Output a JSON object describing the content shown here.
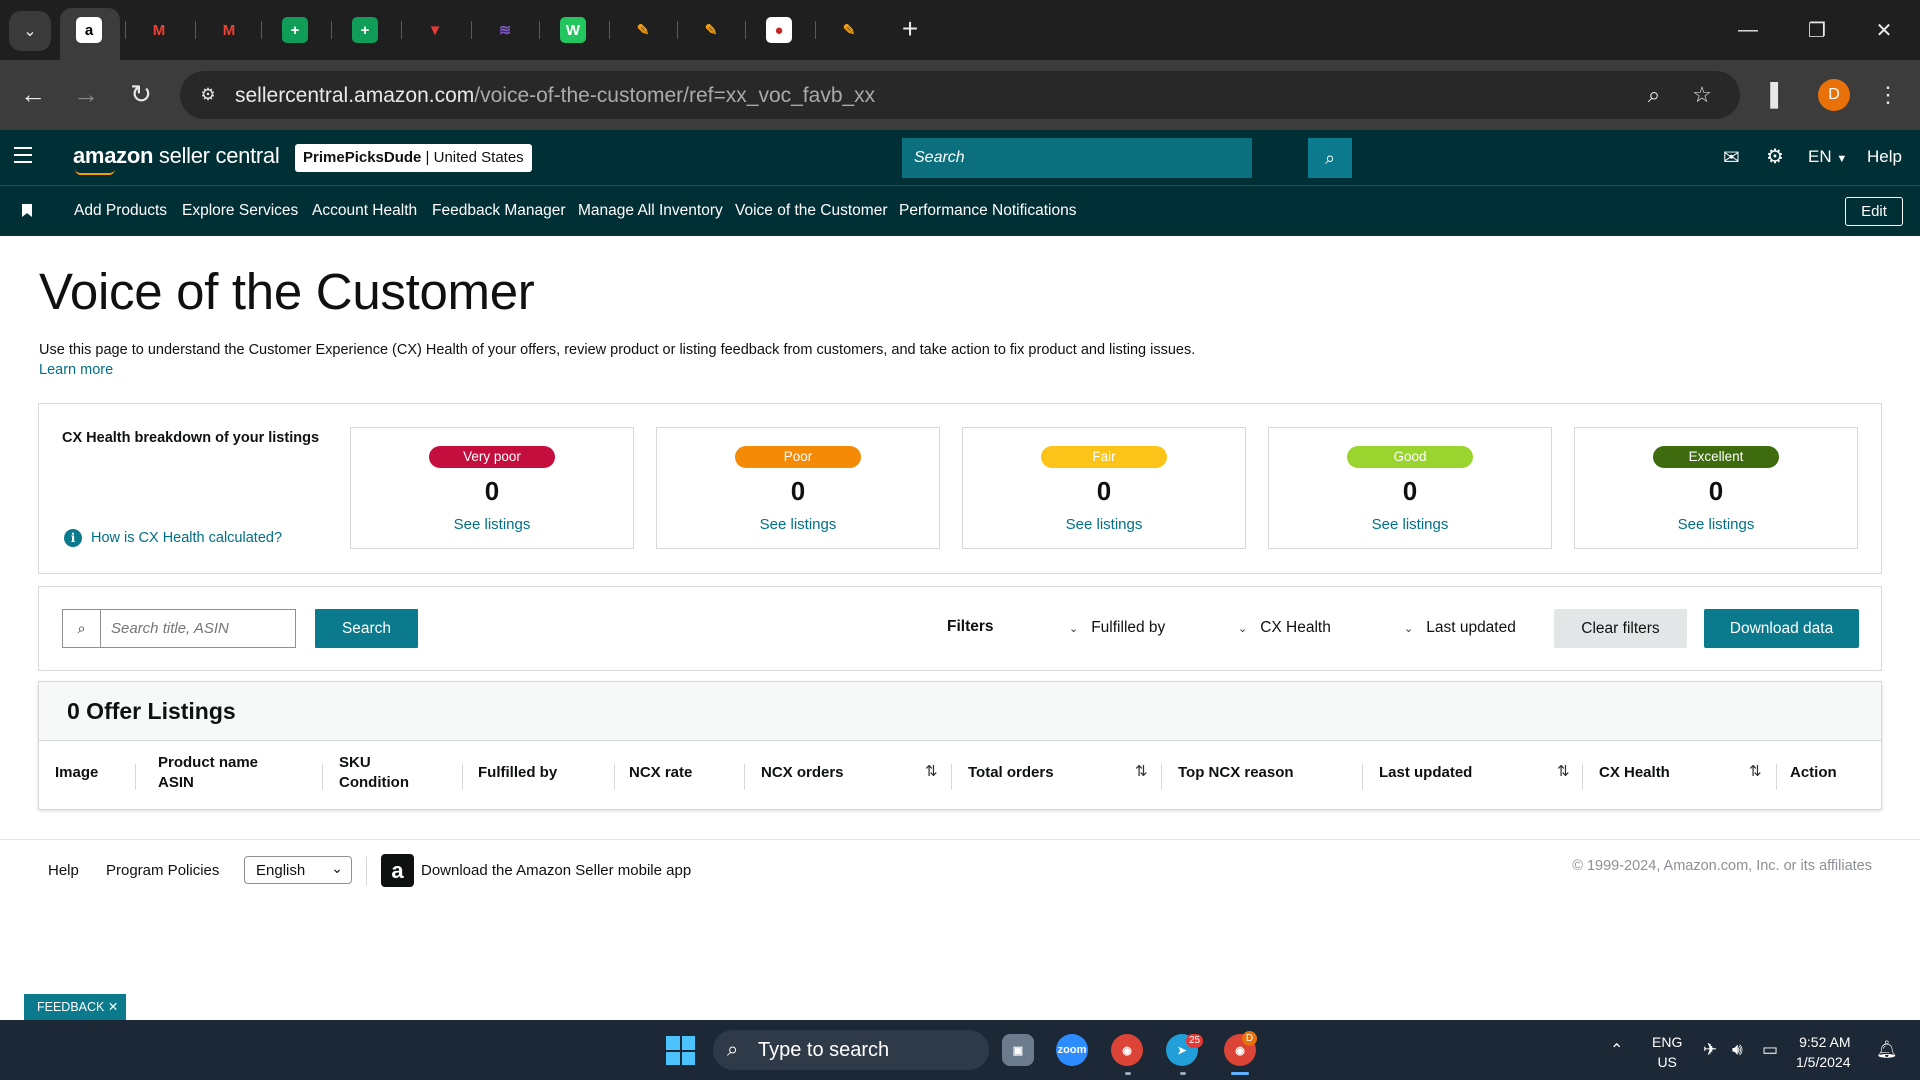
{
  "browser": {
    "tabs": [
      {
        "icon": "amazon-icon",
        "letter": "a",
        "color": "#ffffff",
        "fg": "#000000"
      },
      {
        "icon": "gmail-icon",
        "letter": "M",
        "color": "#1f1f1f",
        "fg": "#ea4335"
      },
      {
        "icon": "gmail-icon",
        "letter": "M",
        "color": "#1f1f1f",
        "fg": "#ea4335"
      },
      {
        "icon": "sheets-icon",
        "letter": "+",
        "color": "#0f9d58",
        "fg": "#ffffff"
      },
      {
        "icon": "sheets-icon",
        "letter": "+",
        "color": "#0f9d58",
        "fg": "#ffffff"
      },
      {
        "icon": "red-logo-icon",
        "letter": "▼",
        "color": "#1f1f1f",
        "fg": "#e53935"
      },
      {
        "icon": "flag-icon",
        "letter": "≋",
        "color": "#1f1f1f",
        "fg": "#7e57c2"
      },
      {
        "icon": "w-logo-icon",
        "letter": "W",
        "color": "#22c55e",
        "fg": "#ffffff"
      },
      {
        "icon": "pencil-icon",
        "letter": "✎",
        "color": "#1f1f1f",
        "fg": "#f59e0b"
      },
      {
        "icon": "pencil-icon",
        "letter": "✎",
        "color": "#1f1f1f",
        "fg": "#f59e0b"
      },
      {
        "icon": "awl-icon",
        "letter": "●",
        "color": "#ffffff",
        "fg": "#c62828"
      },
      {
        "icon": "pencil-icon",
        "letter": "✎",
        "color": "#1f1f1f",
        "fg": "#f59e0b"
      }
    ],
    "url_host": "sellercentral.amazon.com",
    "url_path": "/voice-of-the-customer/ref=xx_voc_favb_xx",
    "profile_initial": "D"
  },
  "header": {
    "logo_bold": "amazon",
    "logo_rest": " seller central",
    "store_name": "PrimePicksDude",
    "store_region": "United States",
    "search_placeholder": "Search",
    "language": "EN",
    "help": "Help"
  },
  "nav": {
    "items": [
      "Add Products",
      "Explore Services",
      "Account Health",
      "Feedback Manager",
      "Manage All Inventory",
      "Voice of the Customer",
      "Performance Notifications"
    ],
    "edit": "Edit"
  },
  "page": {
    "title": "Voice of the Customer",
    "intro": "Use this page to understand the Customer Experience (CX) Health of your offers, review product or listing feedback from customers, and take action to fix product and listing issues.",
    "learn_more": "Learn more"
  },
  "cx_health": {
    "title": "CX Health breakdown of your listings",
    "how_link": "How is CX Health calculated?",
    "cards": [
      {
        "label": "Very poor",
        "count": "0",
        "link": "See listings",
        "color": "#c40f3e"
      },
      {
        "label": "Poor",
        "count": "0",
        "link": "See listings",
        "color": "#f58a07"
      },
      {
        "label": "Fair",
        "count": "0",
        "link": "See listings",
        "color": "#fcc419"
      },
      {
        "label": "Good",
        "count": "0",
        "link": "See listings",
        "color": "#9ad42f"
      },
      {
        "label": "Excellent",
        "count": "0",
        "link": "See listings",
        "color": "#3f6b0f"
      }
    ]
  },
  "filters": {
    "search_placeholder": "Search title, ASIN",
    "search_button": "Search",
    "label": "Filters",
    "dropdowns": [
      "Fulfilled by",
      "CX Health",
      "Last updated"
    ],
    "clear": "Clear filters",
    "download": "Download data"
  },
  "listings": {
    "title": "0 Offer Listings",
    "columns": [
      {
        "line1": "Image",
        "line2": ""
      },
      {
        "line1": "Product name",
        "line2": "ASIN"
      },
      {
        "line1": "SKU",
        "line2": "Condition"
      },
      {
        "line1": "Fulfilled by",
        "line2": ""
      },
      {
        "line1": "NCX rate",
        "line2": ""
      },
      {
        "line1": "NCX orders",
        "line2": ""
      },
      {
        "line1": "Total orders",
        "line2": ""
      },
      {
        "line1": "Top NCX reason",
        "line2": ""
      },
      {
        "line1": "Last updated",
        "line2": ""
      },
      {
        "line1": "CX Health",
        "line2": ""
      },
      {
        "line1": "Action",
        "line2": ""
      }
    ]
  },
  "footer": {
    "help": "Help",
    "policies": "Program Policies",
    "language": "English",
    "app_text": "Download the Amazon Seller mobile app",
    "copyright": "© 1999-2024, Amazon.com, Inc. or its affiliates"
  },
  "feedback": "FEEDBACK",
  "taskbar": {
    "search_text": "Type to search",
    "lang_line1": "ENG",
    "lang_line2": "US",
    "time": "9:52 AM",
    "date": "1/5/2024",
    "telegram_badge": "25",
    "chrome_badge": "D"
  }
}
